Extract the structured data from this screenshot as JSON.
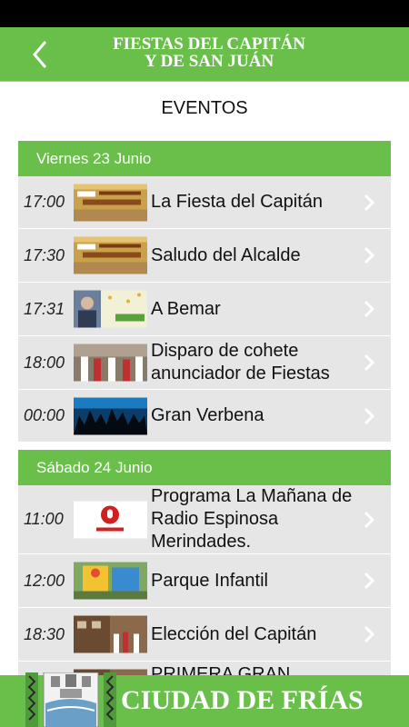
{
  "header": {
    "title_line1": "FIESTAS DEL CAPITÁN",
    "title_line2": "Y DE SAN JUÁN"
  },
  "section_title": "EVENTOS",
  "days": [
    {
      "label": "Viernes 23 Junio",
      "events": [
        {
          "time": "17:00",
          "title": "La Fiesta del Capitán",
          "thumb": "poster"
        },
        {
          "time": "17:30",
          "title": "Saludo del Alcalde",
          "thumb": "poster"
        },
        {
          "time": "17:31",
          "title": "A Bemar",
          "thumb": "bemar"
        },
        {
          "time": "18:00",
          "title": "Disparo de cohete anunciador de Fiestas",
          "thumb": "crowd"
        },
        {
          "time": "00:00",
          "title": "Gran Verbena",
          "thumb": "concert"
        }
      ]
    },
    {
      "label": "Sábado 24 Junio",
      "events": [
        {
          "time": "11:00",
          "title": "Programa La Mañana de Radio Espinosa Merindades.",
          "thumb": "radio"
        },
        {
          "time": "12:00",
          "title": "Parque Infantil",
          "thumb": "park"
        },
        {
          "time": "18:30",
          "title": "Elección del Capitán",
          "thumb": "street"
        },
        {
          "time": "",
          "title": "PRIMERA GRAN",
          "thumb": "street"
        }
      ]
    }
  ],
  "footer": {
    "text": "CIUDAD DE FRÍAS"
  },
  "colors": {
    "accent": "#6abf4b",
    "row_bg": "#e6e6e6"
  }
}
